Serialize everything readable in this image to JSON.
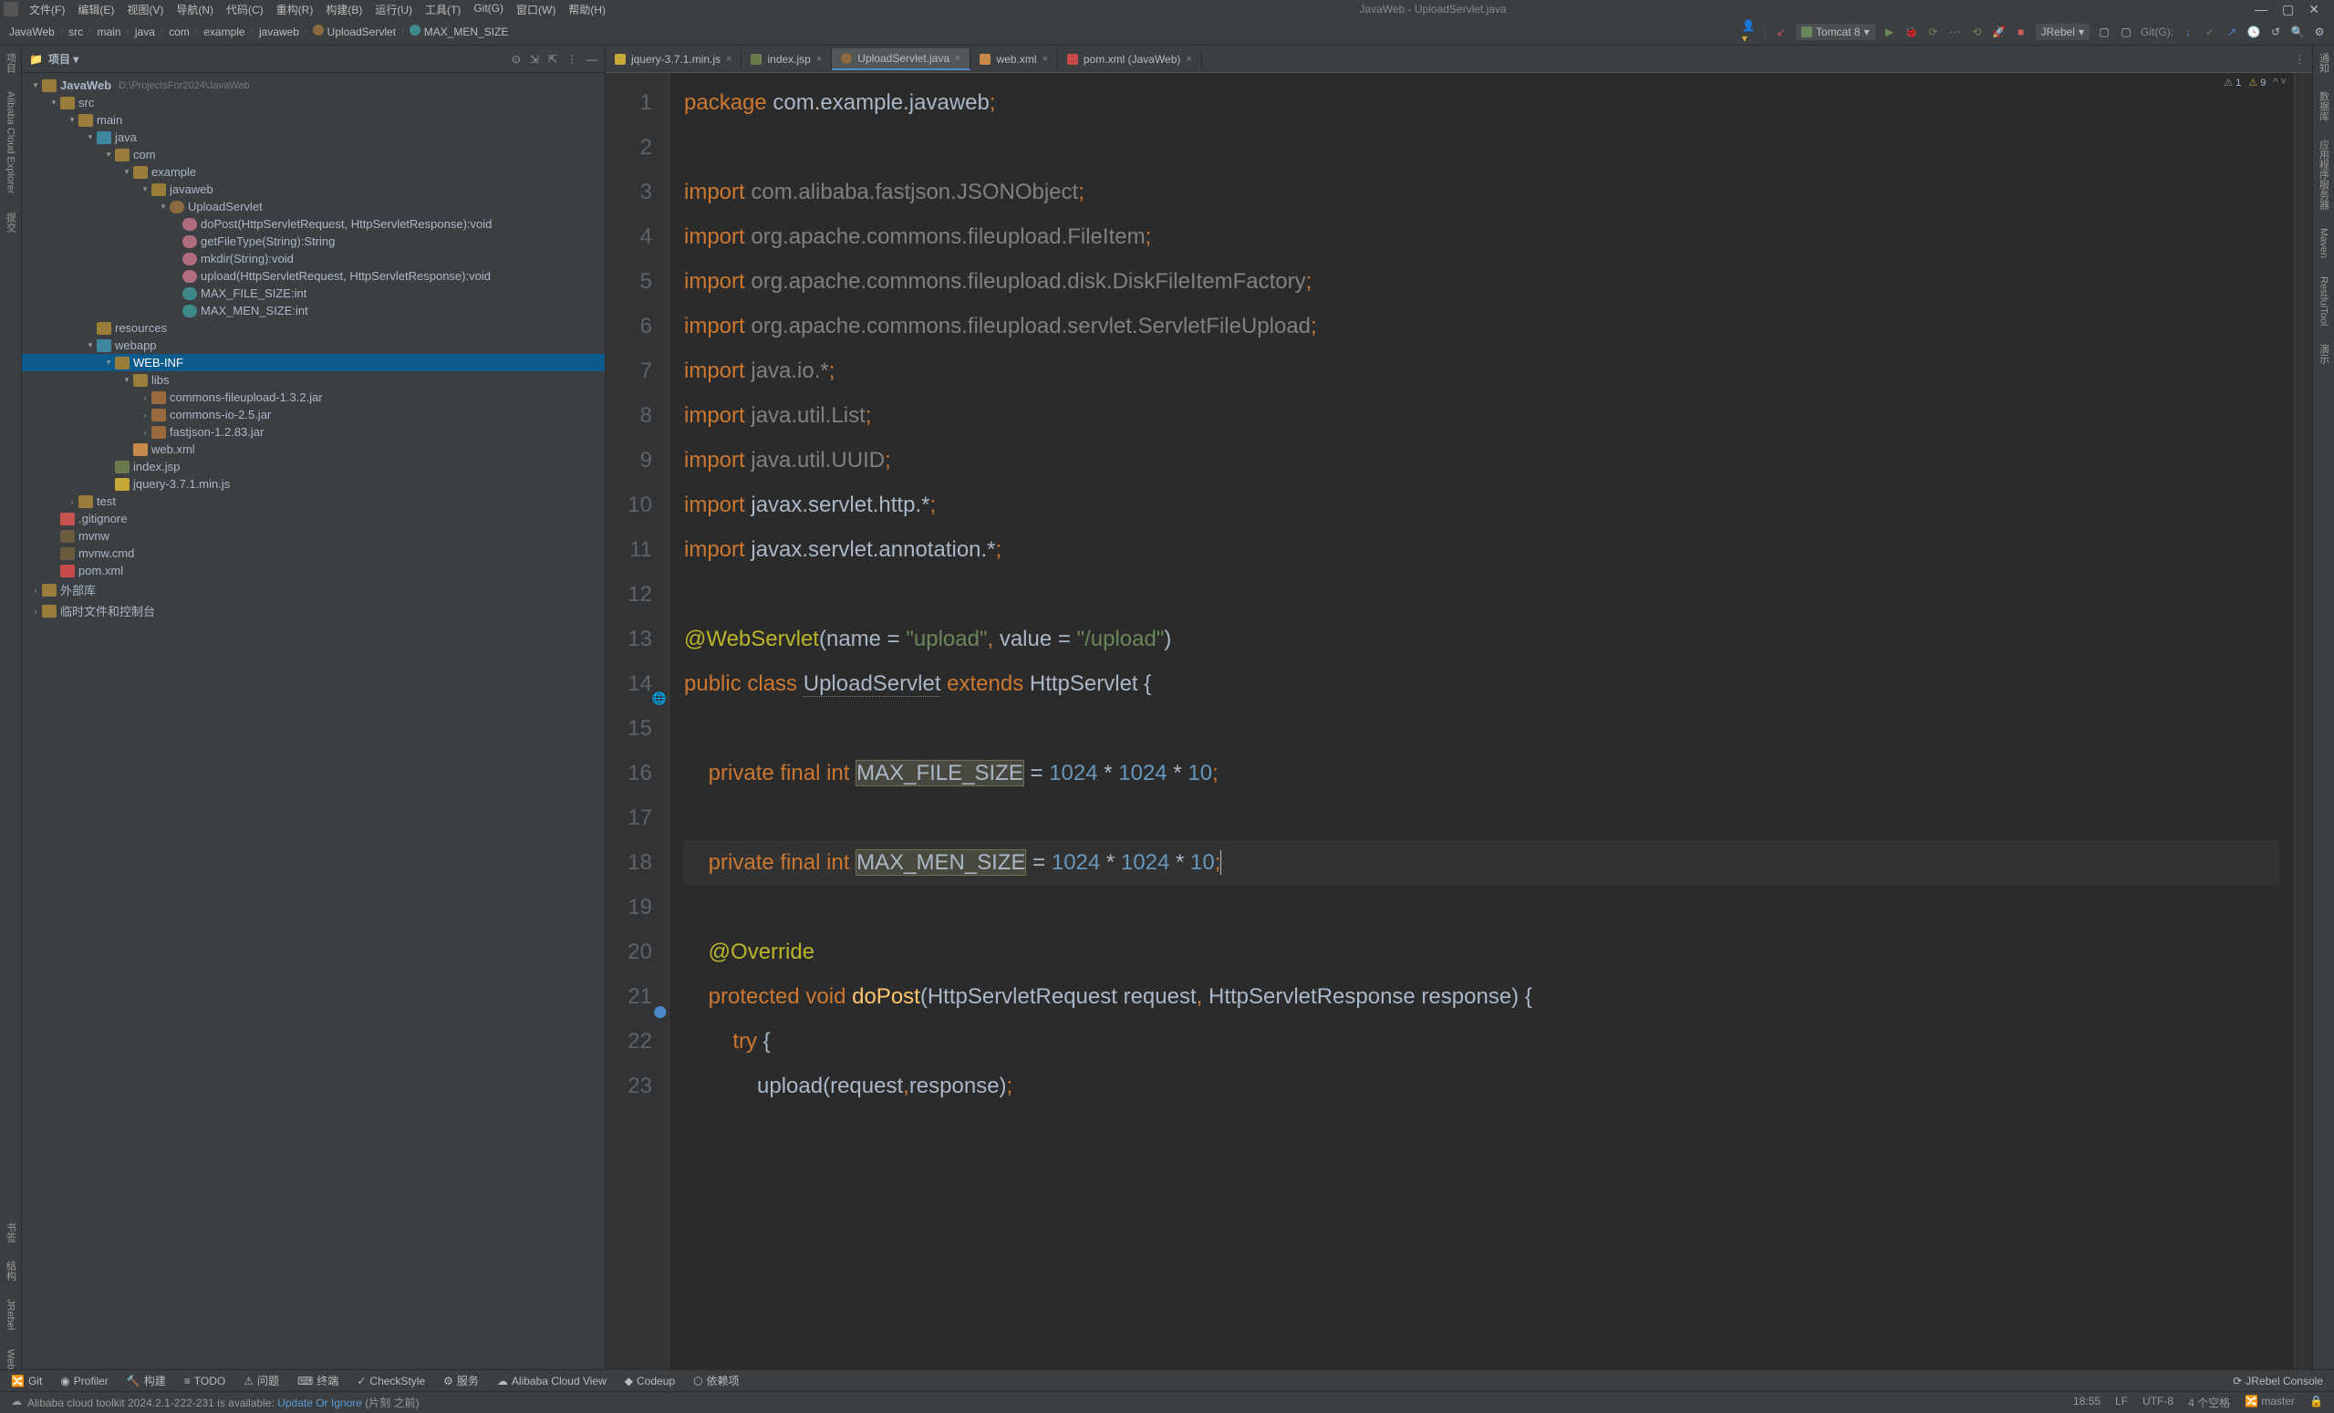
{
  "window": {
    "title": "JavaWeb - UploadServlet.java",
    "menus": [
      "文件(F)",
      "编辑(E)",
      "视图(V)",
      "导航(N)",
      "代码(C)",
      "重构(R)",
      "构建(B)",
      "运行(U)",
      "工具(T)",
      "Git(G)",
      "窗口(W)",
      "帮助(H)"
    ]
  },
  "breadcrumbs": [
    "JavaWeb",
    "src",
    "main",
    "java",
    "com",
    "example",
    "javaweb",
    "UploadServlet",
    "MAX_MEN_SIZE"
  ],
  "toolbar_right": {
    "user_icon": "👤",
    "run_config": "Tomcat 8",
    "gitg": "Git(G):",
    "jrebel": "JRebel"
  },
  "sidebar": {
    "title": "项目",
    "tree": {
      "root": "JavaWeb",
      "root_path": "D:\\ProjectsFor2024\\JavaWeb",
      "src": "src",
      "main": "main",
      "java": "java",
      "com": "com",
      "example": "example",
      "javaweb": "javaweb",
      "upload_cls": "UploadServlet",
      "m_dopost": "doPost(HttpServletRequest, HttpServletResponse):void",
      "m_getfile": "getFileType(String):String",
      "m_mkdir": "mkdir(String):void",
      "m_upload": "upload(HttpServletRequest, HttpServletResponse):void",
      "f_maxfile": "MAX_FILE_SIZE:int",
      "f_maxmen": "MAX_MEN_SIZE:int",
      "resources": "resources",
      "webapp": "webapp",
      "webinf": "WEB-INF",
      "libs": "libs",
      "jar1": "commons-fileupload-1.3.2.jar",
      "jar2": "commons-io-2.5.jar",
      "jar3": "fastjson-1.2.83.jar",
      "webxml": "web.xml",
      "indexjsp": "index.jsp",
      "jquery": "jquery-3.7.1.min.js",
      "test": "test",
      "gitignore": ".gitignore",
      "mvnw": "mvnw",
      "mvnwcmd": "mvnw.cmd",
      "pomxml": "pom.xml",
      "extlib": "外部库",
      "scratch": "临时文件和控制台"
    }
  },
  "tabs": [
    {
      "label": "jquery-3.7.1.min.js"
    },
    {
      "label": "index.jsp"
    },
    {
      "label": "UploadServlet.java",
      "active": true
    },
    {
      "label": "web.xml"
    },
    {
      "label": "pom.xml (JavaWeb)"
    }
  ],
  "inspect": {
    "err_count": "1",
    "warn_icon": "⚠",
    "warn_count": "9"
  },
  "gutter": [
    "1",
    "2",
    "3",
    "4",
    "5",
    "6",
    "7",
    "8",
    "9",
    "10",
    "11",
    "12",
    "13",
    "14",
    "15",
    "16",
    "17",
    "18",
    "19",
    "20",
    "21",
    "22",
    "23"
  ],
  "left_tools": [
    "项目",
    "Alibaba Cloud Explorer",
    "提交"
  ],
  "left_tools_bottom": [
    "书签",
    "结构",
    "JRebel",
    "Web"
  ],
  "right_tools": [
    "通知",
    "数据库",
    "应用程序服务器",
    "Maven",
    "RestfulTool",
    "演示"
  ],
  "bottom_tools": {
    "git": "Git",
    "profiler": "Profiler",
    "build": "构建",
    "todo": "TODO",
    "problems": "问题",
    "terminal": "终端",
    "checkstyle": "CheckStyle",
    "services": "服务",
    "alicloud": "Alibaba Cloud View",
    "codeup": "Codeup",
    "deps": "依赖项",
    "jrebelc": "JRebel Console"
  },
  "status": {
    "msg_prefix": "Alibaba cloud toolkit 2024.2.1-222-231 is available: ",
    "msg_link": "Update Or Ignore",
    "msg_suffix": " (片刻 之前)",
    "pos": "18:55",
    "lineend": "LF",
    "enc": "UTF-8",
    "indent": "4 个空格",
    "branch": "master"
  }
}
